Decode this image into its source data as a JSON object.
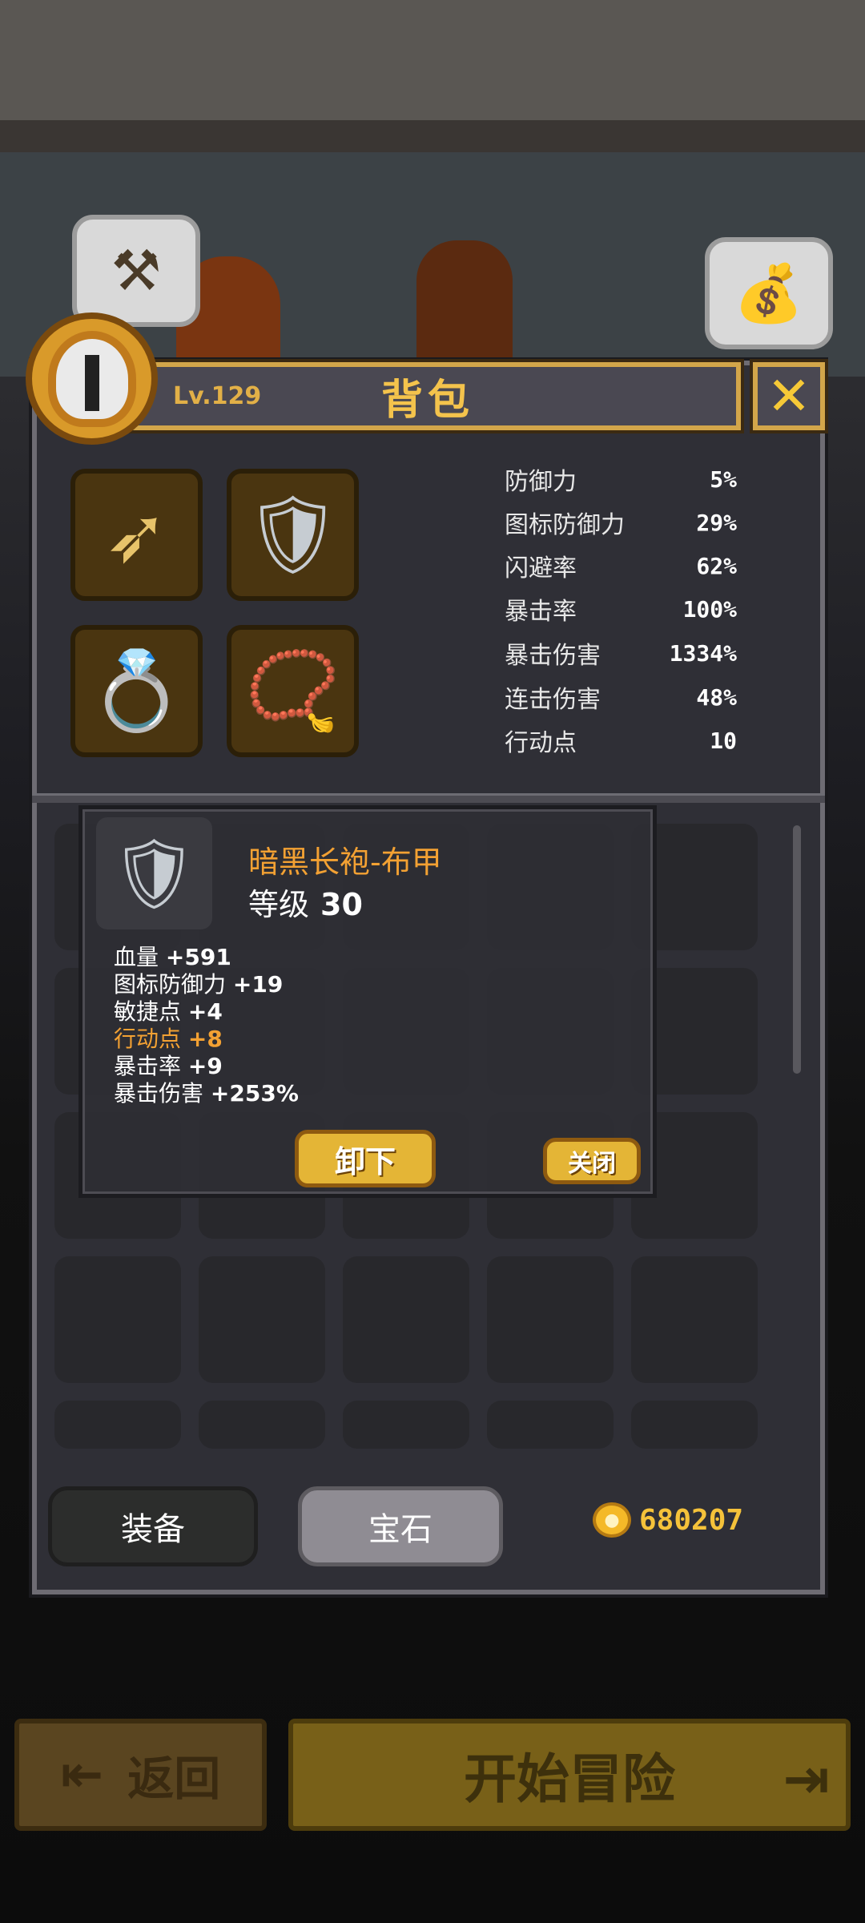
{
  "header": {
    "level": "Lv.129",
    "title": "背包",
    "close_symbol": "✕"
  },
  "bubbles": {
    "left_icon": "hammer-icon",
    "right_icon": "money-bag-icon"
  },
  "equipment": [
    {
      "slot": "weapon",
      "icon": "bow-icon"
    },
    {
      "slot": "armor",
      "icon": "chest-armor-icon"
    },
    {
      "slot": "ring",
      "icon": "ring-icon"
    },
    {
      "slot": "amulet",
      "icon": "amulet-icon"
    }
  ],
  "stats": [
    {
      "label": "防御力",
      "value": "5%"
    },
    {
      "label": "图标防御力",
      "value": "29%"
    },
    {
      "label": "闪避率",
      "value": "62%"
    },
    {
      "label": "暴击率",
      "value": "100%"
    },
    {
      "label": "暴击伤害",
      "value": "1334%"
    },
    {
      "label": "连击伤害",
      "value": "48%"
    },
    {
      "label": "行动点",
      "value": "10"
    }
  ],
  "tooltip": {
    "item_name": "暗黑长袍-布甲",
    "level_label": "等级",
    "level_value": "30",
    "attributes": [
      {
        "label": "血量",
        "value": "+591",
        "highlight": false
      },
      {
        "label": "图标防御力",
        "value": "+19",
        "highlight": false
      },
      {
        "label": "敏捷点",
        "value": "+4",
        "highlight": false
      },
      {
        "label": "行动点",
        "value": "+8",
        "highlight": true
      },
      {
        "label": "暴击率",
        "value": "+9",
        "highlight": false
      },
      {
        "label": "暴击伤害",
        "value": "+253%",
        "highlight": false
      }
    ],
    "unequip_button": "卸下",
    "close_button": "关闭"
  },
  "tabs": {
    "equipment": "装备",
    "gems": "宝石"
  },
  "gold": "680207",
  "bottom": {
    "back_label": "返回",
    "start_label": "开始冒险"
  },
  "colors": {
    "accent_gold": "#e4b536",
    "panel": "#2f2f36",
    "highlight_text": "#f3a133"
  }
}
